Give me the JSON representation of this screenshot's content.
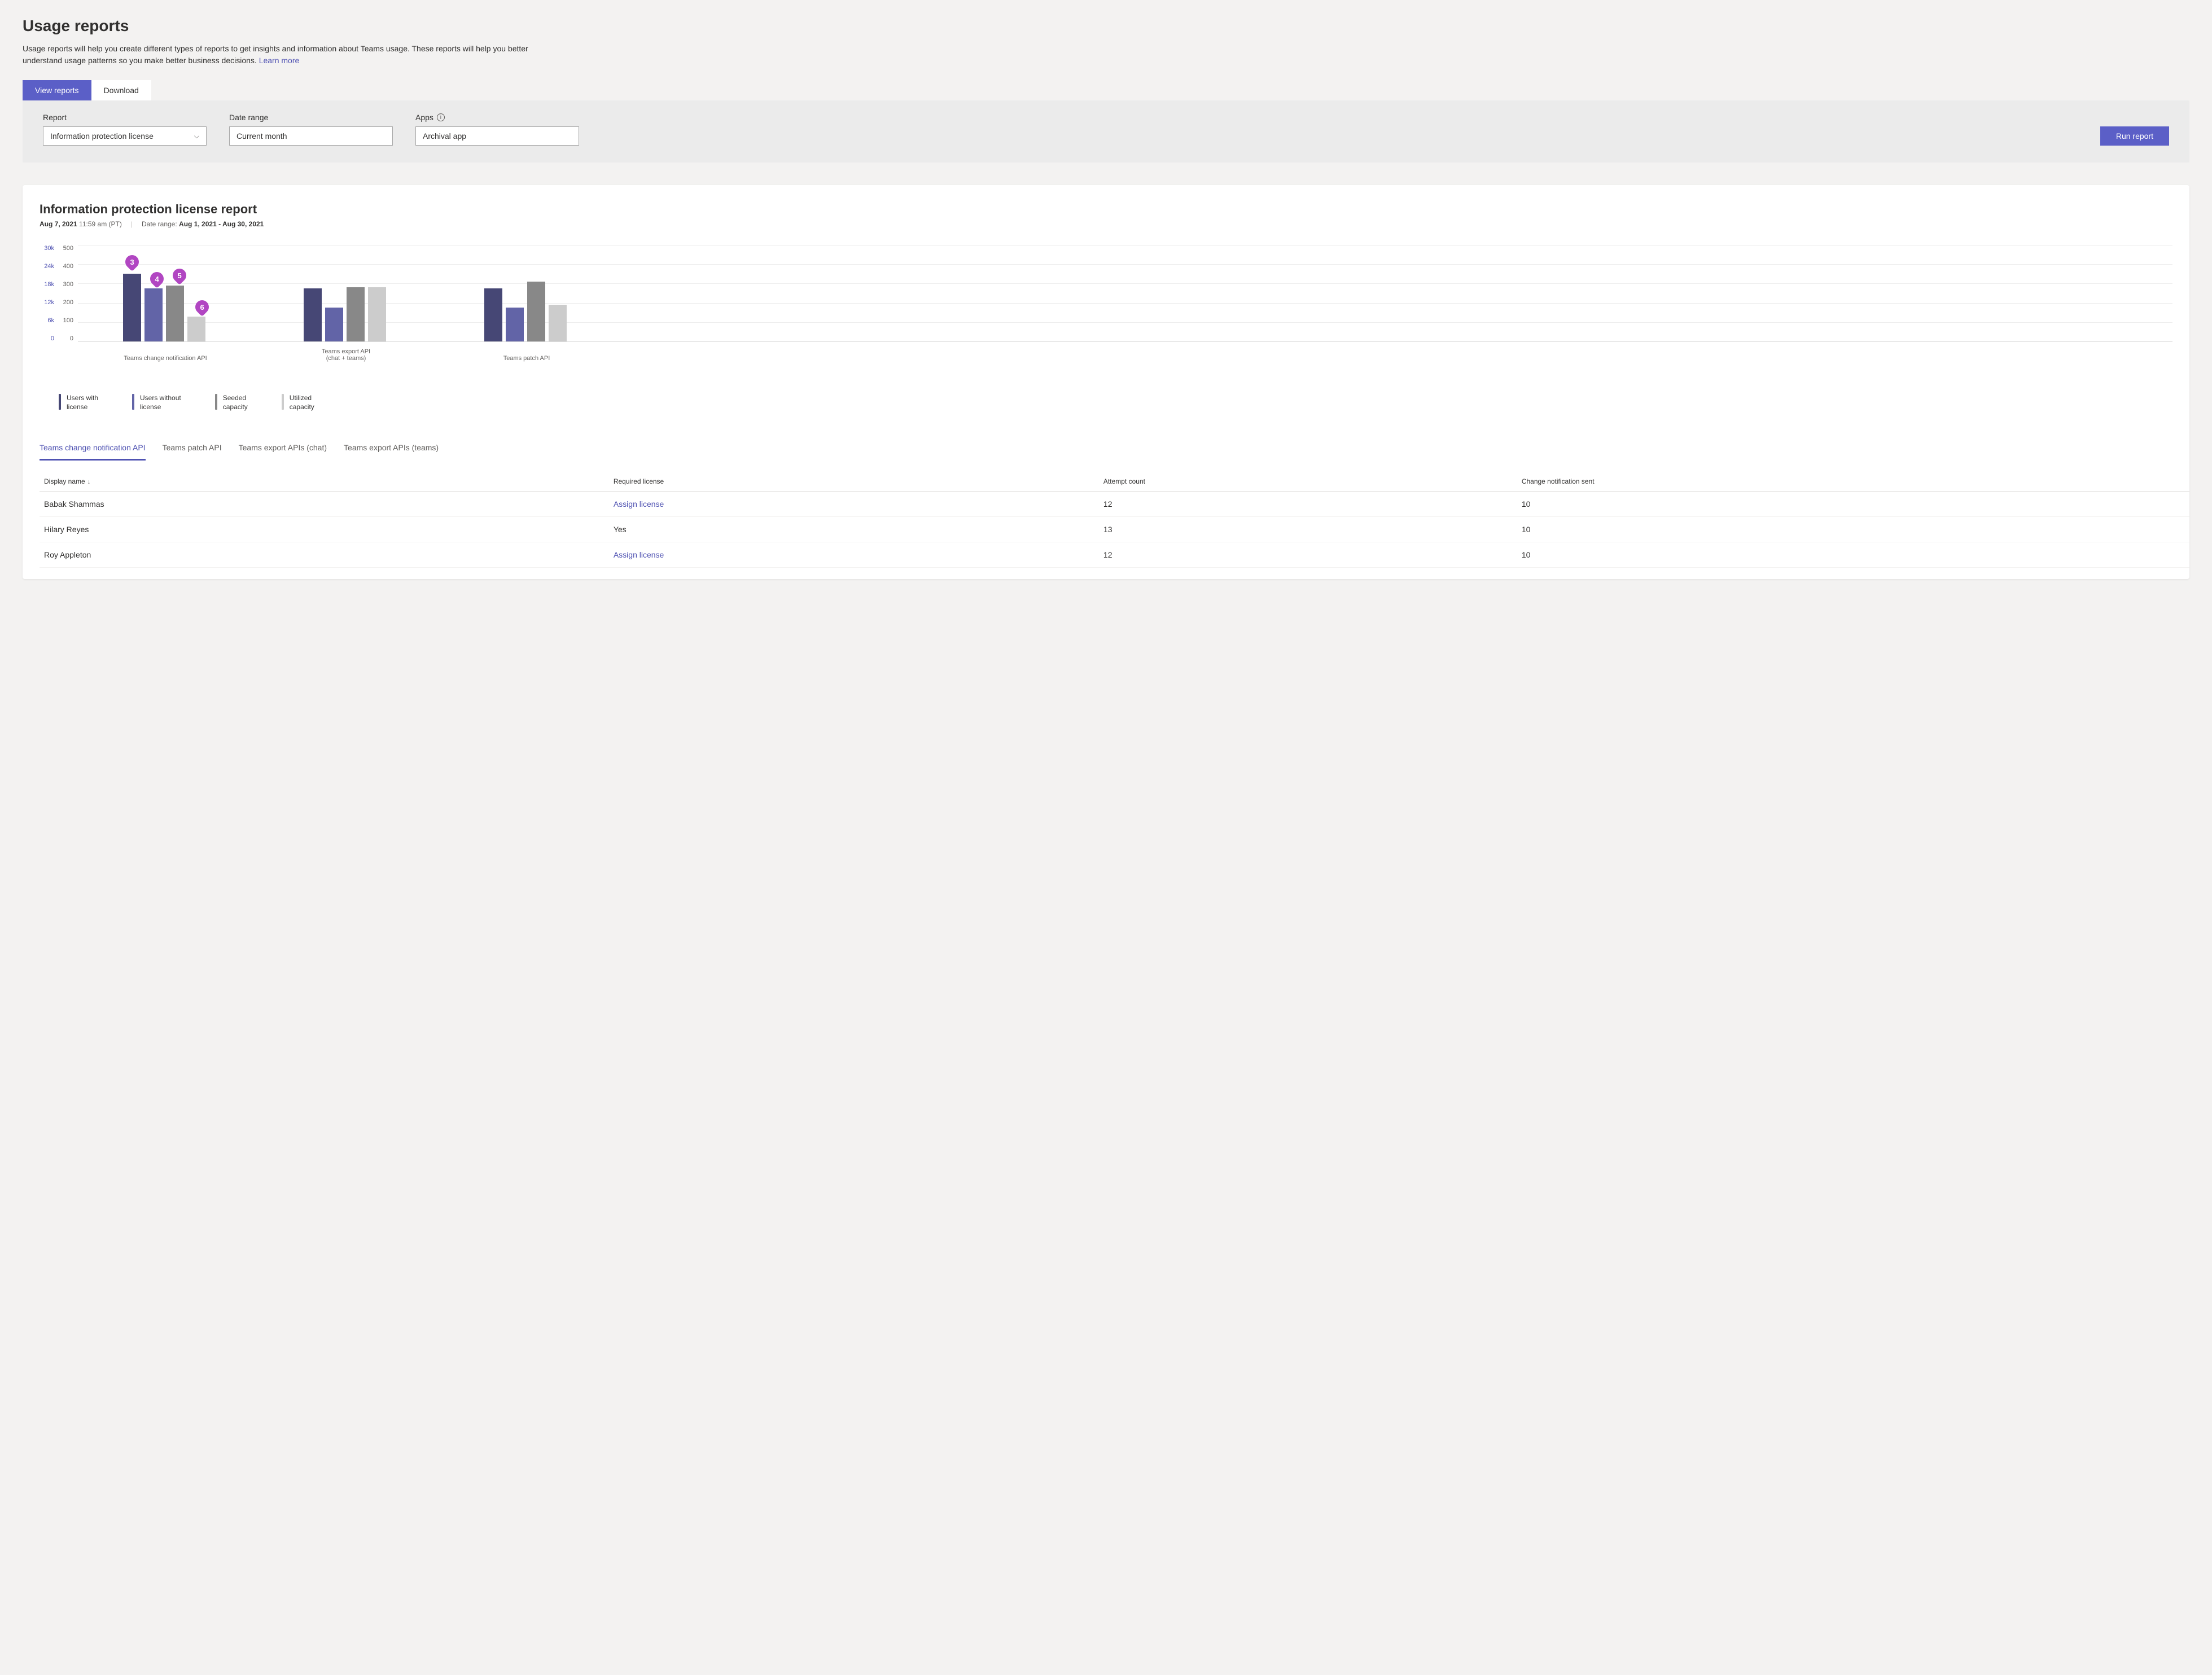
{
  "page": {
    "title": "Usage reports",
    "description": "Usage reports will help you create different types of reports to get insights and information about Teams usage. These reports will help you better understand usage patterns so you make better business decisions.",
    "learn_more": "Learn more"
  },
  "tabs": {
    "view_reports": "View reports",
    "download": "Download"
  },
  "filters": {
    "report_label": "Report",
    "report_value": "Information protection license",
    "date_label": "Date range",
    "date_value": "Current month",
    "apps_label": "Apps",
    "apps_value": "Archival app",
    "run_button": "Run report"
  },
  "report": {
    "title": "Information protection license report",
    "date_label": "Aug 7, 2021",
    "time_tz": "11:59 am (PT)",
    "range_label": "Date range:",
    "range_value": "Aug 1, 2021 - Aug 30, 2021"
  },
  "chart_data": {
    "type": "bar",
    "y1_ticks": [
      "30k",
      "24k",
      "18k",
      "12k",
      "6k",
      "0"
    ],
    "y2_ticks": [
      "500",
      "400",
      "300",
      "200",
      "100",
      "0"
    ],
    "categories": [
      "Teams change notification API",
      "Teams export API\n(chat + teams)",
      "Teams patch API"
    ],
    "legend": [
      "Users with license",
      "Users without license",
      "Seeded capacity",
      "Utilized capacity"
    ],
    "series": [
      {
        "name": "Users with license",
        "axis": 1,
        "values": [
          21000,
          16500,
          16500
        ]
      },
      {
        "name": "Users without license",
        "axis": 1,
        "values": [
          16500,
          10500,
          10500
        ]
      },
      {
        "name": "Seeded capacity",
        "axis": 2,
        "values": [
          290,
          280,
          310
        ]
      },
      {
        "name": "Utilized capacity",
        "axis": 2,
        "values": [
          130,
          280,
          190
        ]
      }
    ],
    "y1_max": 30000,
    "y2_max": 500,
    "annotations": [
      "3",
      "4",
      "5",
      "6"
    ]
  },
  "subtabs": [
    "Teams change notification API",
    "Teams patch API",
    "Teams export APIs (chat)",
    "Teams export APIs (teams)"
  ],
  "table": {
    "columns": [
      "Display name",
      "Required license",
      "Attempt count",
      "Change notification sent"
    ],
    "rows": [
      {
        "name": "Babak Shammas",
        "license": "Assign license",
        "license_link": true,
        "attempt": "12",
        "sent": "10"
      },
      {
        "name": "Hilary Reyes",
        "license": "Yes",
        "license_link": false,
        "attempt": "13",
        "sent": "10"
      },
      {
        "name": "Roy Appleton",
        "license": "Assign license",
        "license_link": true,
        "attempt": "12",
        "sent": "10"
      }
    ]
  }
}
